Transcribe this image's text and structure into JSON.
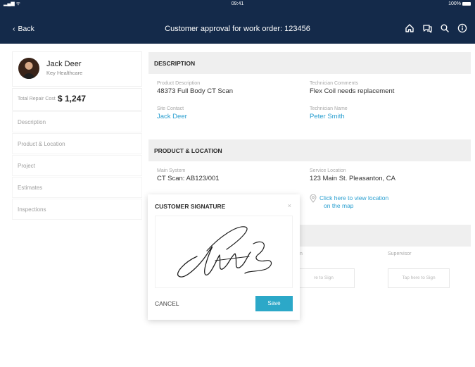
{
  "status_bar": {
    "signal": "all",
    "time": "09:41",
    "battery": "100%"
  },
  "nav": {
    "back_label": "Back",
    "title": "Customer approval for work order: 123456",
    "icons": [
      "home-icon",
      "chat-icon",
      "search-icon",
      "info-icon"
    ]
  },
  "profile": {
    "name": "Jack Deer",
    "organization": "Key Healthcare",
    "cost_label": "Total Repair Cost",
    "cost_value": "$ 1,247"
  },
  "sidebar": {
    "items": [
      {
        "label": "Description"
      },
      {
        "label": "Product & Location"
      },
      {
        "label": "Project"
      },
      {
        "label": "Estimates"
      },
      {
        "label": "Inspections"
      }
    ]
  },
  "description": {
    "header": "DESCRIPTION",
    "product_description_label": "Product Description",
    "product_description_value": "48373 Full Body CT Scan",
    "technician_comments_label": "Technician Comments",
    "technician_comments_value": "Flex Coil needs replacement",
    "site_contact_label": "Site Contact",
    "site_contact_value": "Jack Deer",
    "technician_name_label": "Technician Name",
    "technician_name_value": "Peter Smith"
  },
  "product_location": {
    "header": "PRODUCT & LOCATION",
    "main_system_label": "Main System",
    "main_system_value": "CT Scan: AB123/001",
    "service_location_label": "Service Location",
    "service_location_value": "123 Main St. Pleasanton, CA",
    "location_link_line1": "Click here to view location",
    "location_link_line2": "on the map"
  },
  "signatures": {
    "technician_partial_label": "n",
    "technician_partial_button": "re to Sign",
    "supervisor_label": "Supervisor",
    "supervisor_button": "Tap here to Sign"
  },
  "modal": {
    "title": "CUSTOMER SIGNATURE",
    "close": "×",
    "cancel_label": "CANCEL",
    "save_label": "Save"
  },
  "colors": {
    "nav_bg": "#142a4a",
    "accent": "#2a9fd0",
    "save_button": "#2ca8c8",
    "section_header_bg": "#efefef"
  }
}
